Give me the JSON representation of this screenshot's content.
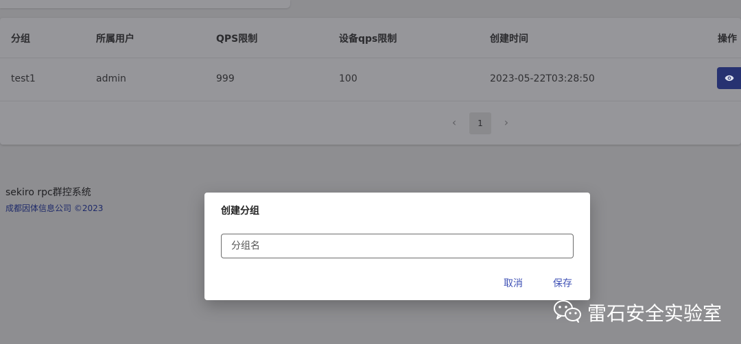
{
  "table": {
    "headers": [
      "分组",
      "所属用户",
      "QPS限制",
      "设备qps限制",
      "创建时间",
      "操作"
    ],
    "rows": [
      {
        "group": "test1",
        "user": "admin",
        "qps": "999",
        "device_qps": "100",
        "created": "2023-05-22T03:28:50",
        "action_icon": "eye-icon"
      }
    ]
  },
  "pagination": {
    "prev": "‹",
    "current": "1",
    "next": "›"
  },
  "footer": {
    "title": "sekiro rpc群控系统",
    "copyright": "成都因体信息公司 ©2023"
  },
  "dialog": {
    "title": "创建分组",
    "input_placeholder": "分组名",
    "input_value": "",
    "cancel_label": "取消",
    "save_label": "保存"
  },
  "watermark": {
    "text": "雷石安全实验室",
    "icon": "wechat-icon"
  },
  "colors": {
    "accent": "#3f51b5",
    "button_dark": "#273271",
    "overlay": "#8e8e91"
  }
}
